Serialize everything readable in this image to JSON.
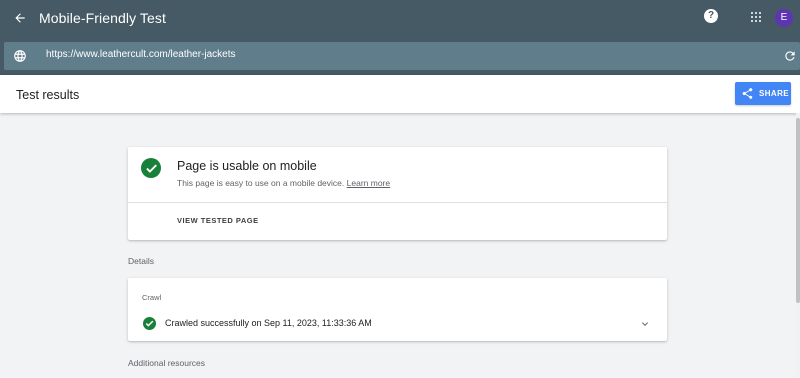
{
  "app": {
    "title": "Mobile-Friendly Test",
    "help_glyph": "?",
    "avatar_initial": "E",
    "accent": "#455a64"
  },
  "urlbar": {
    "value": "https://www.leathercult.com/leather-jackets"
  },
  "results": {
    "title": "Test results",
    "share_label": "SHARE"
  },
  "verdict": {
    "heading": "Page is usable on mobile",
    "description": "This page is easy to use on a mobile device.",
    "learn_more": "Learn more",
    "view_tested_page": "VIEW TESTED PAGE",
    "status_color": "#188038"
  },
  "details": {
    "section_label": "Details",
    "crawl_label": "Crawl",
    "crawl_status": "Crawled successfully on Sep 11, 2023, 11:33:36 AM"
  },
  "additional": {
    "section_label": "Additional resources"
  }
}
